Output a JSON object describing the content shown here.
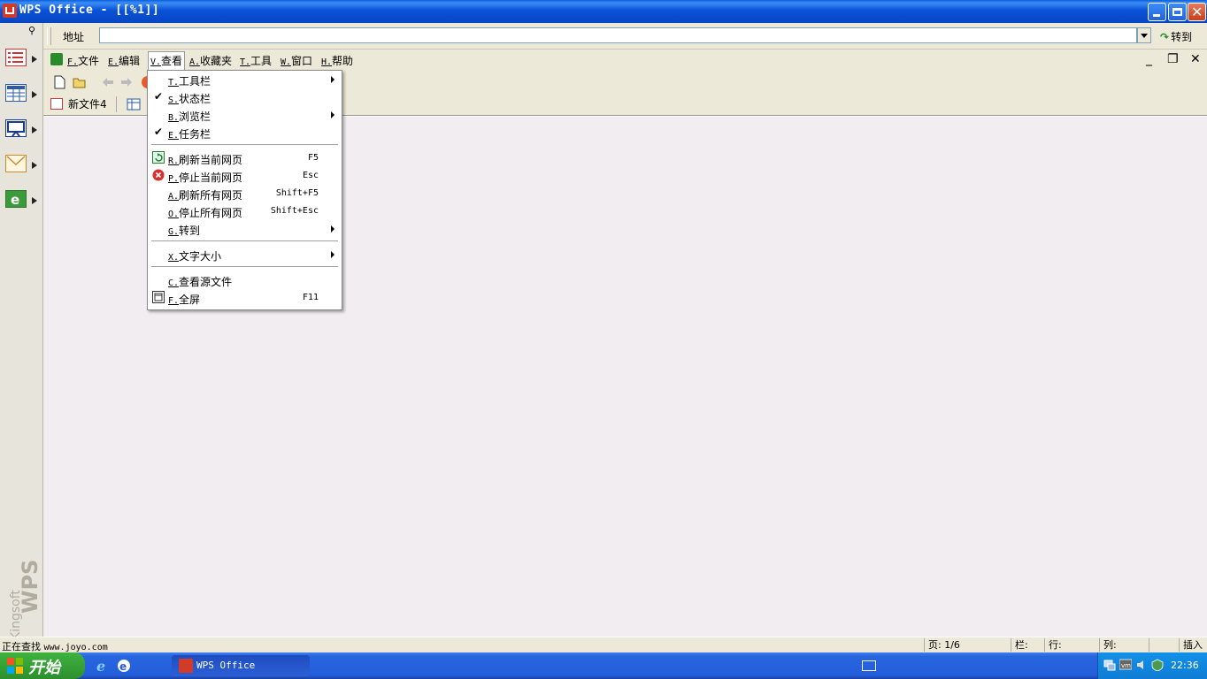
{
  "window": {
    "title": "WPS Office - [[%1]]"
  },
  "address_bar": {
    "label": "地址",
    "value": "",
    "go_label": "转到"
  },
  "menubar": {
    "items": [
      {
        "accel": "F.",
        "label": "文件"
      },
      {
        "accel": "E.",
        "label": "编辑"
      },
      {
        "accel": "V.",
        "label": "查看"
      },
      {
        "accel": "A.",
        "label": "收藏夹"
      },
      {
        "accel": "T.",
        "label": "工具"
      },
      {
        "accel": "W.",
        "label": "窗口"
      },
      {
        "accel": "H.",
        "label": "帮助"
      }
    ]
  },
  "tabs": {
    "doc1": "新文件4"
  },
  "view_menu": {
    "items": [
      {
        "accel": "T.",
        "label": "工具栏",
        "checked": false,
        "submenu": true,
        "shortcut": ""
      },
      {
        "accel": "S.",
        "label": "状态栏",
        "checked": true,
        "submenu": false,
        "shortcut": ""
      },
      {
        "accel": "B.",
        "label": "浏览栏",
        "checked": false,
        "submenu": true,
        "shortcut": ""
      },
      {
        "accel": "E.",
        "label": "任务栏",
        "checked": true,
        "submenu": false,
        "shortcut": ""
      },
      {
        "accel": "R.",
        "label": "刷新当前网页",
        "icon": "refresh-icon",
        "shortcut": "F5"
      },
      {
        "accel": "P.",
        "label": "停止当前网页",
        "icon": "stop-icon",
        "shortcut": "Esc"
      },
      {
        "accel": "A.",
        "label": "刷新所有网页",
        "shortcut": "Shift+F5"
      },
      {
        "accel": "O.",
        "label": "停止所有网页",
        "shortcut": "Shift+Esc"
      },
      {
        "accel": "G.",
        "label": "转到",
        "submenu": true,
        "shortcut": ""
      },
      {
        "accel": "X.",
        "label": "文字大小",
        "submenu": true,
        "shortcut": ""
      },
      {
        "accel": "C.",
        "label": "查看源文件",
        "shortcut": ""
      },
      {
        "accel": "F.",
        "label": "全屏",
        "icon": "fullscreen-icon",
        "shortcut": "F11"
      }
    ]
  },
  "statusbar": {
    "message": "正在查找",
    "url": "www.joyo.com",
    "page": "页: 1/6",
    "section": "栏:",
    "row": "行:",
    "col": "列:",
    "mode": "插入"
  },
  "sidebar": {
    "brand_small": "Kingsoft",
    "brand_large": "WPS"
  },
  "taskbar": {
    "start_label": "开始",
    "task_label": "WPS Office",
    "clock": "22:36"
  },
  "colors": {
    "title_blue": "#0a52d8",
    "close_red": "#c8401d",
    "start_green": "#2d8f2d",
    "content_bg": "#f1edf1"
  }
}
